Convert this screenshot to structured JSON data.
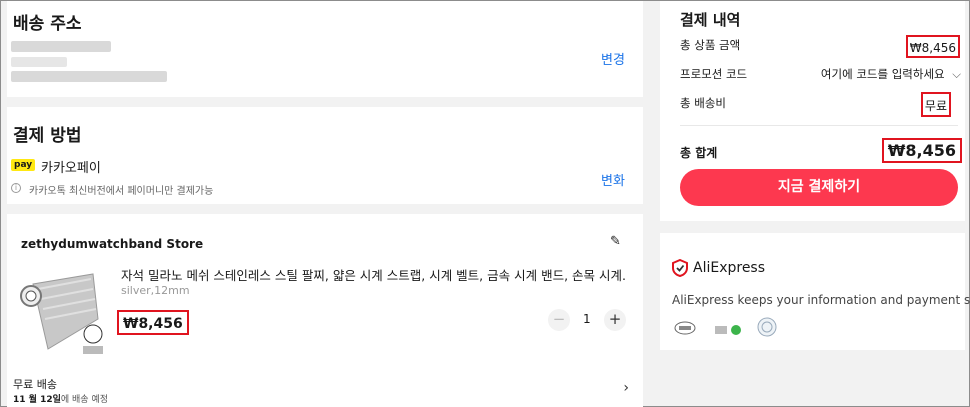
{
  "shipping": {
    "title": "배송 주소",
    "change": "변경"
  },
  "payment": {
    "title": "결제 방법",
    "pay_badge": "pay",
    "method": "카카오페이",
    "change": "변화",
    "notice": "카카오톡 최신버전에서 페이머니만 결제가능"
  },
  "store": {
    "name": "zethydumwatchband Store",
    "product_title": "자석 밀라노 메쉬 스테인레스 스틸 팔찌, 얇은 시계 스트랩, 시계 벨트, 금속 시계 밴드, 손목 시계...",
    "variant": "silver,12mm",
    "price": "₩8,456",
    "qty": "1",
    "shipping": "무료 배송",
    "delivery_date": "11 월 12일",
    "delivery_suffix": "에 배송 예정"
  },
  "summary": {
    "title": "결제 내역",
    "subtotal_label": "총 상품 금액",
    "subtotal_value": "₩8,456",
    "promo_label": "프로모션 코드",
    "promo_placeholder": "여기에 코드를 입력하세요",
    "shipping_label": "총 배송비",
    "shipping_value": "무료",
    "total_label": "총 합계",
    "total_value": "₩8,456",
    "pay_button": "지금 결제하기"
  },
  "trust": {
    "brand": "AliExpress",
    "text": "AliExpress keeps your information and payment safe"
  },
  "colors": {
    "accent": "#fd384f",
    "link": "#1a73e8",
    "highlight": "#e0141f",
    "kakao": "#ffe812"
  }
}
